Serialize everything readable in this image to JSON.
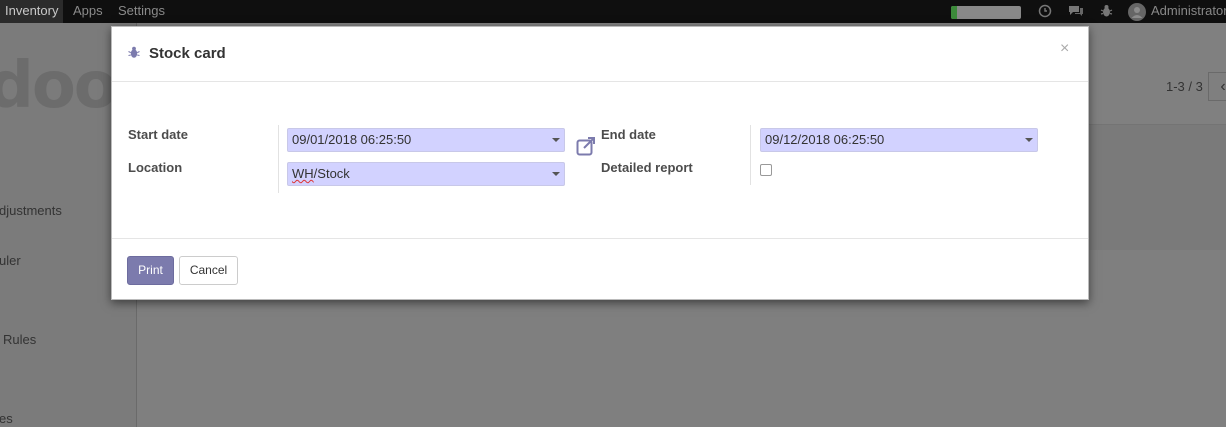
{
  "topbar": {
    "menu": [
      "Inventory",
      "Apps",
      "Settings"
    ],
    "active_menu": "Inventory",
    "progress_fraction": 0.08,
    "user_name": "Administrator",
    "icons": [
      "clock-icon",
      "chat-icon",
      "bug-icon",
      "avatar-icon"
    ]
  },
  "sidebar": {
    "logo_text": "doo",
    "items": [
      "djustments",
      "uler",
      "Rules",
      "es"
    ]
  },
  "control_panel": {
    "pager_value": "1-3 / 3",
    "pager_prev": "‹"
  },
  "modal": {
    "title": "Stock card",
    "close_label": "×",
    "start_date_label": "Start date",
    "start_date_value": "09/01/2018 06:25:50",
    "end_date_label": "End date",
    "end_date_value": "09/12/2018 06:25:50",
    "location_label": "Location",
    "location_value_underlined": "WH",
    "location_value_rest": "/Stock",
    "detailed_report_label": "Detailed report",
    "detailed_report_checked": false,
    "print_label": "Print",
    "cancel_label": "Cancel"
  },
  "colors": {
    "accent": "#7c7bad",
    "field_bg": "#d2d2ff",
    "overlay": "#7f7f7f"
  }
}
